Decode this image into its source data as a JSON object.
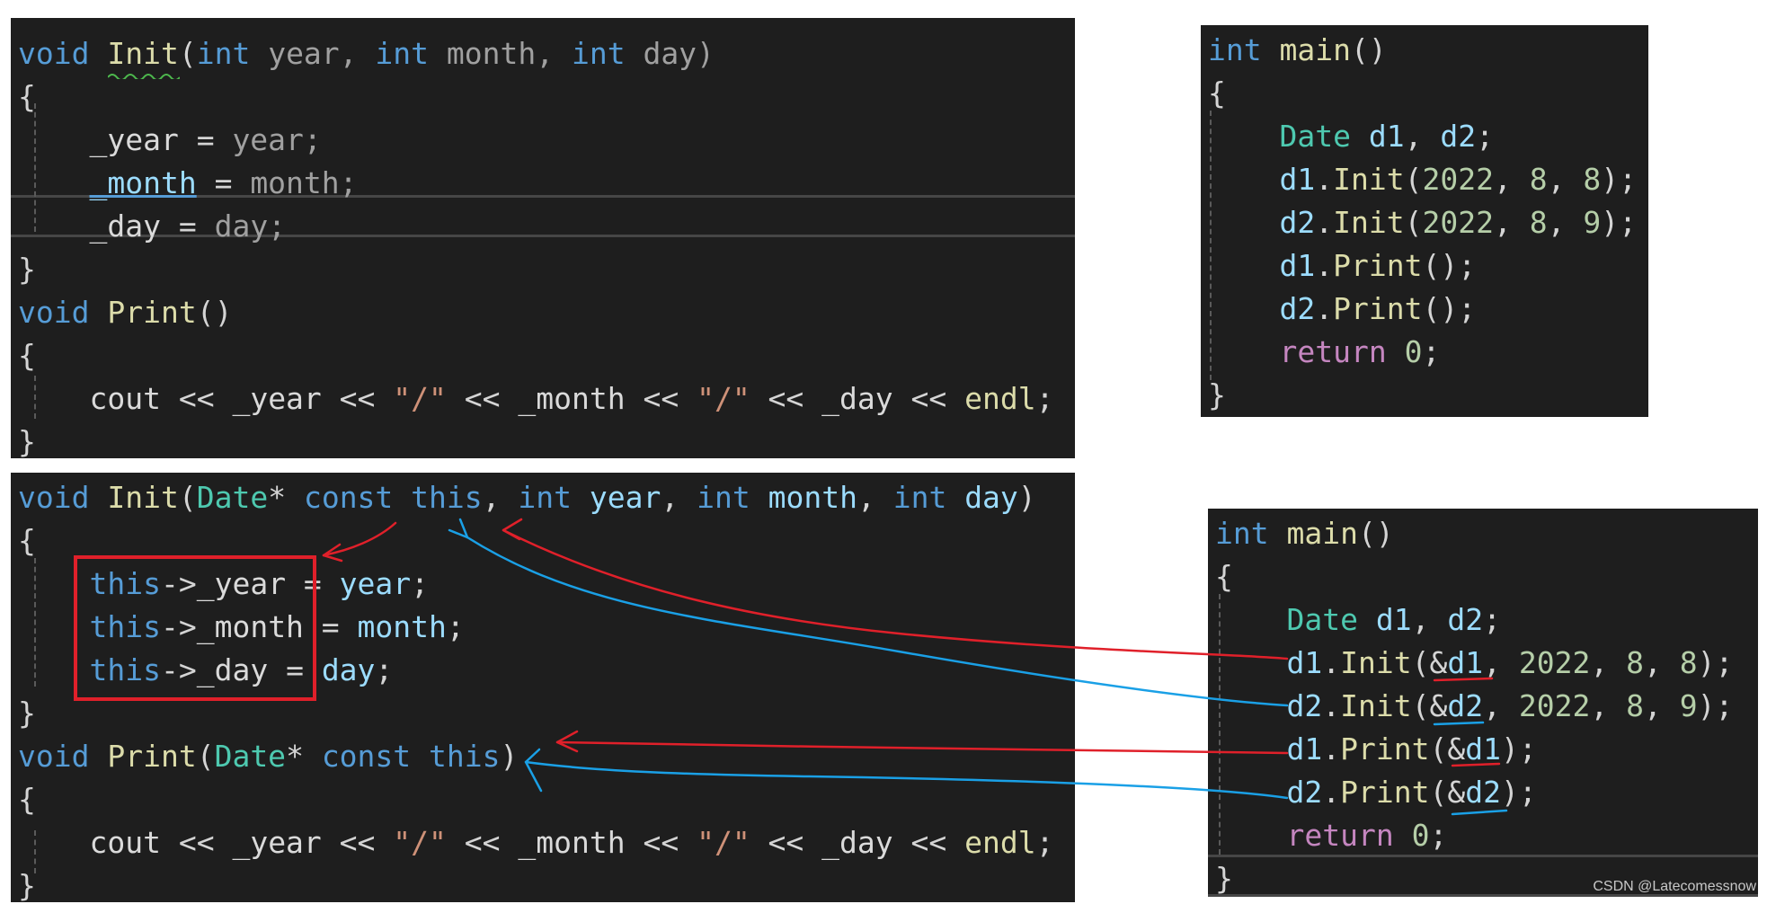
{
  "panels": {
    "init_print_original": [
      [
        {
          "t": "void",
          "c": "kw"
        },
        {
          "t": " "
        },
        {
          "t": "Init",
          "c": "fn"
        },
        {
          "t": "("
        },
        {
          "t": "int",
          "c": "kw"
        },
        {
          "t": " year, ",
          "c": "dim"
        },
        {
          "t": "int",
          "c": "kw"
        },
        {
          "t": " month, ",
          "c": "dim"
        },
        {
          "t": "int",
          "c": "kw"
        },
        {
          "t": " day)",
          "c": "dim"
        }
      ],
      [
        {
          "t": "{"
        }
      ],
      [
        {
          "t": "    "
        },
        {
          "t": "_year",
          "c": "mem"
        },
        {
          "t": " = "
        },
        {
          "t": "year;",
          "c": "dim"
        }
      ],
      [
        {
          "t": "    "
        },
        {
          "t": "_month",
          "c": "var ul"
        },
        {
          "t": " = "
        },
        {
          "t": "month;",
          "c": "dim"
        }
      ],
      [
        {
          "t": "    "
        },
        {
          "t": "_day",
          "c": "mem"
        },
        {
          "t": " = "
        },
        {
          "t": "day;",
          "c": "dim"
        }
      ],
      [
        {
          "t": "}"
        }
      ],
      [
        {
          "t": "void",
          "c": "kw"
        },
        {
          "t": " "
        },
        {
          "t": "Print",
          "c": "fn"
        },
        {
          "t": "()"
        }
      ],
      [
        {
          "t": "{"
        }
      ],
      [
        {
          "t": "    "
        },
        {
          "t": "cout",
          "c": "mem"
        },
        {
          "t": " << "
        },
        {
          "t": "_year",
          "c": "mem"
        },
        {
          "t": " << "
        },
        {
          "t": "\"/\"",
          "c": "str"
        },
        {
          "t": " << "
        },
        {
          "t": "_month",
          "c": "mem"
        },
        {
          "t": " << "
        },
        {
          "t": "\"/\"",
          "c": "str"
        },
        {
          "t": " << "
        },
        {
          "t": "_day",
          "c": "mem"
        },
        {
          "t": " << "
        },
        {
          "t": "endl",
          "c": "fn"
        },
        {
          "t": ";"
        }
      ],
      [
        {
          "t": "}"
        }
      ]
    ],
    "main_original": [
      [
        {
          "t": "int",
          "c": "kw"
        },
        {
          "t": " "
        },
        {
          "t": "main",
          "c": "fn"
        },
        {
          "t": "()"
        }
      ],
      [
        {
          "t": "{"
        }
      ],
      [
        {
          "t": "    "
        },
        {
          "t": "Date",
          "c": "type"
        },
        {
          "t": " "
        },
        {
          "t": "d1",
          "c": "var"
        },
        {
          "t": ", "
        },
        {
          "t": "d2",
          "c": "var"
        },
        {
          "t": ";"
        }
      ],
      [
        {
          "t": "    "
        },
        {
          "t": "d1",
          "c": "var"
        },
        {
          "t": "."
        },
        {
          "t": "Init",
          "c": "fn"
        },
        {
          "t": "("
        },
        {
          "t": "2022",
          "c": "num"
        },
        {
          "t": ", "
        },
        {
          "t": "8",
          "c": "num"
        },
        {
          "t": ", "
        },
        {
          "t": "8",
          "c": "num"
        },
        {
          "t": ");"
        }
      ],
      [
        {
          "t": "    "
        },
        {
          "t": "d2",
          "c": "var"
        },
        {
          "t": "."
        },
        {
          "t": "Init",
          "c": "fn"
        },
        {
          "t": "("
        },
        {
          "t": "2022",
          "c": "num"
        },
        {
          "t": ", "
        },
        {
          "t": "8",
          "c": "num"
        },
        {
          "t": ", "
        },
        {
          "t": "9",
          "c": "num"
        },
        {
          "t": ");"
        }
      ],
      [
        {
          "t": "    "
        },
        {
          "t": "d1",
          "c": "var"
        },
        {
          "t": "."
        },
        {
          "t": "Print",
          "c": "fn"
        },
        {
          "t": "();"
        }
      ],
      [
        {
          "t": "    "
        },
        {
          "t": "d2",
          "c": "var"
        },
        {
          "t": "."
        },
        {
          "t": "Print",
          "c": "fn"
        },
        {
          "t": "();"
        }
      ],
      [
        {
          "t": "    "
        },
        {
          "t": "return",
          "c": "ctl"
        },
        {
          "t": " "
        },
        {
          "t": "0",
          "c": "num"
        },
        {
          "t": ";"
        }
      ],
      [
        {
          "t": "}"
        }
      ]
    ],
    "init_print_this": [
      [
        {
          "t": "void",
          "c": "kw"
        },
        {
          "t": " "
        },
        {
          "t": "Init",
          "c": "fn"
        },
        {
          "t": "("
        },
        {
          "t": "Date",
          "c": "type"
        },
        {
          "t": "* "
        },
        {
          "t": "const",
          "c": "kw"
        },
        {
          "t": " "
        },
        {
          "t": "this",
          "c": "kw"
        },
        {
          "t": ", "
        },
        {
          "t": "int",
          "c": "kw"
        },
        {
          "t": " "
        },
        {
          "t": "year",
          "c": "var"
        },
        {
          "t": ", "
        },
        {
          "t": "int",
          "c": "kw"
        },
        {
          "t": " "
        },
        {
          "t": "month",
          "c": "var"
        },
        {
          "t": ", "
        },
        {
          "t": "int",
          "c": "kw"
        },
        {
          "t": " "
        },
        {
          "t": "day",
          "c": "var"
        },
        {
          "t": ")"
        }
      ],
      [
        {
          "t": "{"
        }
      ],
      [
        {
          "t": "    "
        },
        {
          "t": "this",
          "c": "kw"
        },
        {
          "t": "->"
        },
        {
          "t": "_year",
          "c": "mem"
        },
        {
          "t": " = "
        },
        {
          "t": "year",
          "c": "var"
        },
        {
          "t": ";"
        }
      ],
      [
        {
          "t": "    "
        },
        {
          "t": "this",
          "c": "kw"
        },
        {
          "t": "->"
        },
        {
          "t": "_month",
          "c": "mem"
        },
        {
          "t": " = "
        },
        {
          "t": "month",
          "c": "var"
        },
        {
          "t": ";"
        }
      ],
      [
        {
          "t": "    "
        },
        {
          "t": "this",
          "c": "kw"
        },
        {
          "t": "->"
        },
        {
          "t": "_day",
          "c": "mem"
        },
        {
          "t": " = "
        },
        {
          "t": "day",
          "c": "var"
        },
        {
          "t": ";"
        }
      ],
      [
        {
          "t": "}"
        }
      ],
      [
        {
          "t": "void",
          "c": "kw"
        },
        {
          "t": " "
        },
        {
          "t": "Print",
          "c": "fn"
        },
        {
          "t": "("
        },
        {
          "t": "Date",
          "c": "type"
        },
        {
          "t": "* "
        },
        {
          "t": "const",
          "c": "kw"
        },
        {
          "t": " "
        },
        {
          "t": "this",
          "c": "kw"
        },
        {
          "t": ")"
        }
      ],
      [
        {
          "t": "{"
        }
      ],
      [
        {
          "t": "    "
        },
        {
          "t": "cout",
          "c": "mem"
        },
        {
          "t": " << "
        },
        {
          "t": "_year",
          "c": "mem"
        },
        {
          "t": " << "
        },
        {
          "t": "\"/\"",
          "c": "str"
        },
        {
          "t": " << "
        },
        {
          "t": "_month",
          "c": "mem"
        },
        {
          "t": " << "
        },
        {
          "t": "\"/\"",
          "c": "str"
        },
        {
          "t": " << "
        },
        {
          "t": "_day",
          "c": "mem"
        },
        {
          "t": " << "
        },
        {
          "t": "endl",
          "c": "fn"
        },
        {
          "t": ";"
        }
      ],
      [
        {
          "t": "}"
        }
      ]
    ],
    "main_this": [
      [
        {
          "t": "int",
          "c": "kw"
        },
        {
          "t": " "
        },
        {
          "t": "main",
          "c": "fn"
        },
        {
          "t": "()"
        }
      ],
      [
        {
          "t": "{"
        }
      ],
      [
        {
          "t": "    "
        },
        {
          "t": "Date",
          "c": "type"
        },
        {
          "t": " "
        },
        {
          "t": "d1",
          "c": "var"
        },
        {
          "t": ", "
        },
        {
          "t": "d2",
          "c": "var"
        },
        {
          "t": ";"
        }
      ],
      [
        {
          "t": "    "
        },
        {
          "t": "d1",
          "c": "var"
        },
        {
          "t": "."
        },
        {
          "t": "Init",
          "c": "fn"
        },
        {
          "t": "("
        },
        {
          "t": "&"
        },
        {
          "t": "d1",
          "c": "var"
        },
        {
          "t": ", "
        },
        {
          "t": "2022",
          "c": "num"
        },
        {
          "t": ", "
        },
        {
          "t": "8",
          "c": "num"
        },
        {
          "t": ", "
        },
        {
          "t": "8",
          "c": "num"
        },
        {
          "t": ");"
        }
      ],
      [
        {
          "t": "    "
        },
        {
          "t": "d2",
          "c": "var"
        },
        {
          "t": "."
        },
        {
          "t": "Init",
          "c": "fn"
        },
        {
          "t": "("
        },
        {
          "t": "&"
        },
        {
          "t": "d2",
          "c": "var"
        },
        {
          "t": ", "
        },
        {
          "t": "2022",
          "c": "num"
        },
        {
          "t": ", "
        },
        {
          "t": "8",
          "c": "num"
        },
        {
          "t": ", "
        },
        {
          "t": "9",
          "c": "num"
        },
        {
          "t": ");"
        }
      ],
      [
        {
          "t": "    "
        },
        {
          "t": "d1",
          "c": "var"
        },
        {
          "t": "."
        },
        {
          "t": "Print",
          "c": "fn"
        },
        {
          "t": "("
        },
        {
          "t": "&"
        },
        {
          "t": "d1",
          "c": "var"
        },
        {
          "t": ");"
        }
      ],
      [
        {
          "t": "    "
        },
        {
          "t": "d2",
          "c": "var"
        },
        {
          "t": "."
        },
        {
          "t": "Print",
          "c": "fn"
        },
        {
          "t": "("
        },
        {
          "t": "&"
        },
        {
          "t": "d2",
          "c": "var"
        },
        {
          "t": ");"
        }
      ],
      [
        {
          "t": "    "
        },
        {
          "t": "return",
          "c": "ctl"
        },
        {
          "t": " "
        },
        {
          "t": "0",
          "c": "num"
        },
        {
          "t": ";"
        }
      ],
      [
        {
          "t": "}"
        }
      ]
    ]
  },
  "colors": {
    "editor_background": "#1e1e1e",
    "keyword": "#569cd6",
    "function": "#dcdcaa",
    "type": "#4ec9b0",
    "number": "#b5cea8",
    "string": "#ce9178",
    "control": "#c586c0",
    "annotation_red": "#e0202a",
    "annotation_blue": "#1aa0e6"
  },
  "watermark": "CSDN @Latecomessnow"
}
